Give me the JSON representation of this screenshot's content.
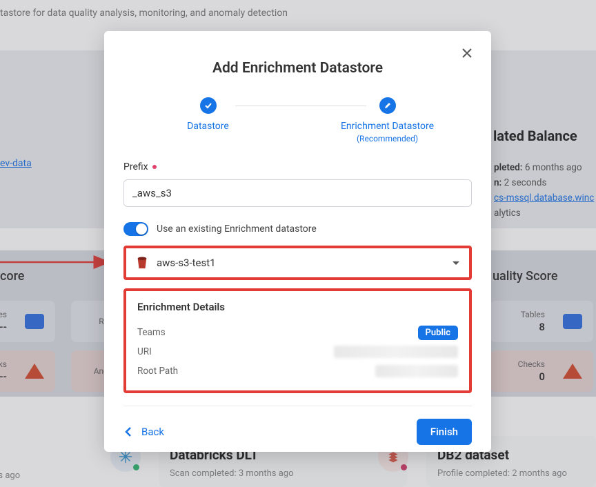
{
  "background": {
    "header_subtitle": "tastore for data quality analysis, monitoring, and anomaly detection",
    "left_link": "ev-data",
    "card_title_right": "lated Balance",
    "status": {
      "completed_label": "pleted:",
      "completed_val": "6 months ago",
      "duration_label": "n:",
      "duration_val": "2 seconds",
      "host_link": "cs-mssql.database.winc",
      "analytics": "alytics"
    },
    "score_left": "core",
    "score_right": "uality Score",
    "cards": {
      "c1_k": "es",
      "c1_v": "--",
      "c2_k": "Re",
      "c3_k": "ks",
      "c3_v": "--",
      "c4_k": "Ano",
      "c5_k": "Tables",
      "c5_v": "8",
      "c6_k": "Checks",
      "c6_v": "0"
    },
    "ds": {
      "left_sub": "months ago",
      "mid_title": "Databricks DLT",
      "mid_sub": "Scan completed: 3 months ago",
      "right_title": "DB2 dataset",
      "right_sub": "Profile completed: 2 months ago"
    }
  },
  "modal": {
    "title": "Add Enrichment Datastore",
    "step1": "Datastore",
    "step2": "Enrichment Datastore",
    "step2_sub": "(Recommended)",
    "prefix_label": "Prefix",
    "prefix_value": "_aws_s3",
    "toggle_label": "Use an existing Enrichment datastore",
    "selected_datastore": "aws-s3-test1",
    "details": {
      "heading": "Enrichment Details",
      "teams_label": "Teams",
      "teams_badge": "Public",
      "uri_label": "URI",
      "root_label": "Root Path"
    },
    "back": "Back",
    "finish": "Finish"
  }
}
